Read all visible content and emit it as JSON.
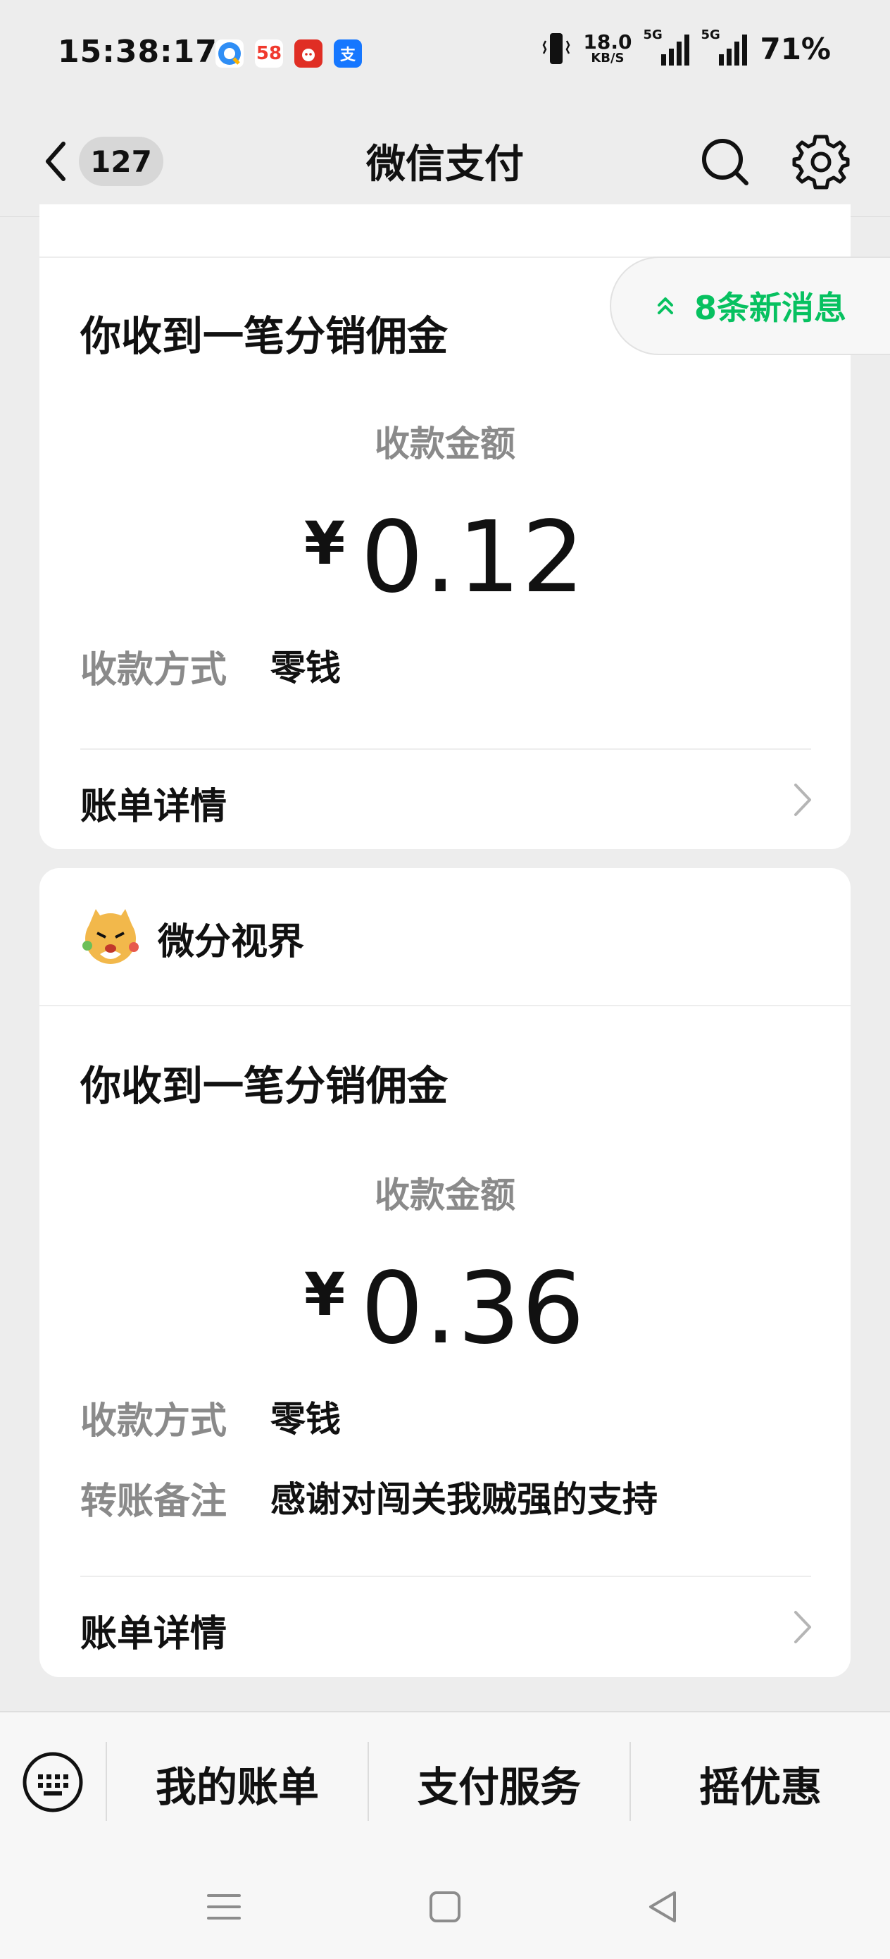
{
  "status_bar": {
    "time": "15:38:17",
    "app_icons": [
      {
        "name": "qq-browser",
        "label": "",
        "color": "#3b8cf0"
      },
      {
        "name": "58-tongcheng",
        "label": "58",
        "color": "#f0392d"
      },
      {
        "name": "pinduoduo",
        "label": "",
        "color": "#e02e24"
      },
      {
        "name": "alipay",
        "label": "支",
        "color": "#1677ff"
      }
    ],
    "net_speed_value": "18.0",
    "net_speed_unit": "KB/S",
    "signal_tag_1": "5G",
    "signal_tag_2": "5G",
    "battery": "71%"
  },
  "nav": {
    "unread_count": "127",
    "title": "微信支付"
  },
  "new_messages": {
    "label": "8条新消息",
    "accent": "#07c160"
  },
  "cards": [
    {
      "heading": "你收到一笔分销佣金",
      "amount_label": "收款金额",
      "currency": "¥",
      "amount": "0.12",
      "rows": [
        {
          "label": "收款方式",
          "value": "零钱"
        }
      ],
      "detail_label": "账单详情"
    },
    {
      "merchant": "微分视界",
      "heading": "你收到一笔分销佣金",
      "amount_label": "收款金额",
      "currency": "¥",
      "amount": "0.36",
      "rows": [
        {
          "label": "收款方式",
          "value": "零钱"
        },
        {
          "label": "转账备注",
          "value": "感谢对闯关我贼强的支持"
        }
      ],
      "detail_label": "账单详情"
    }
  ],
  "bottom_menu": {
    "items": [
      "我的账单",
      "支付服务",
      "摇优惠"
    ]
  }
}
